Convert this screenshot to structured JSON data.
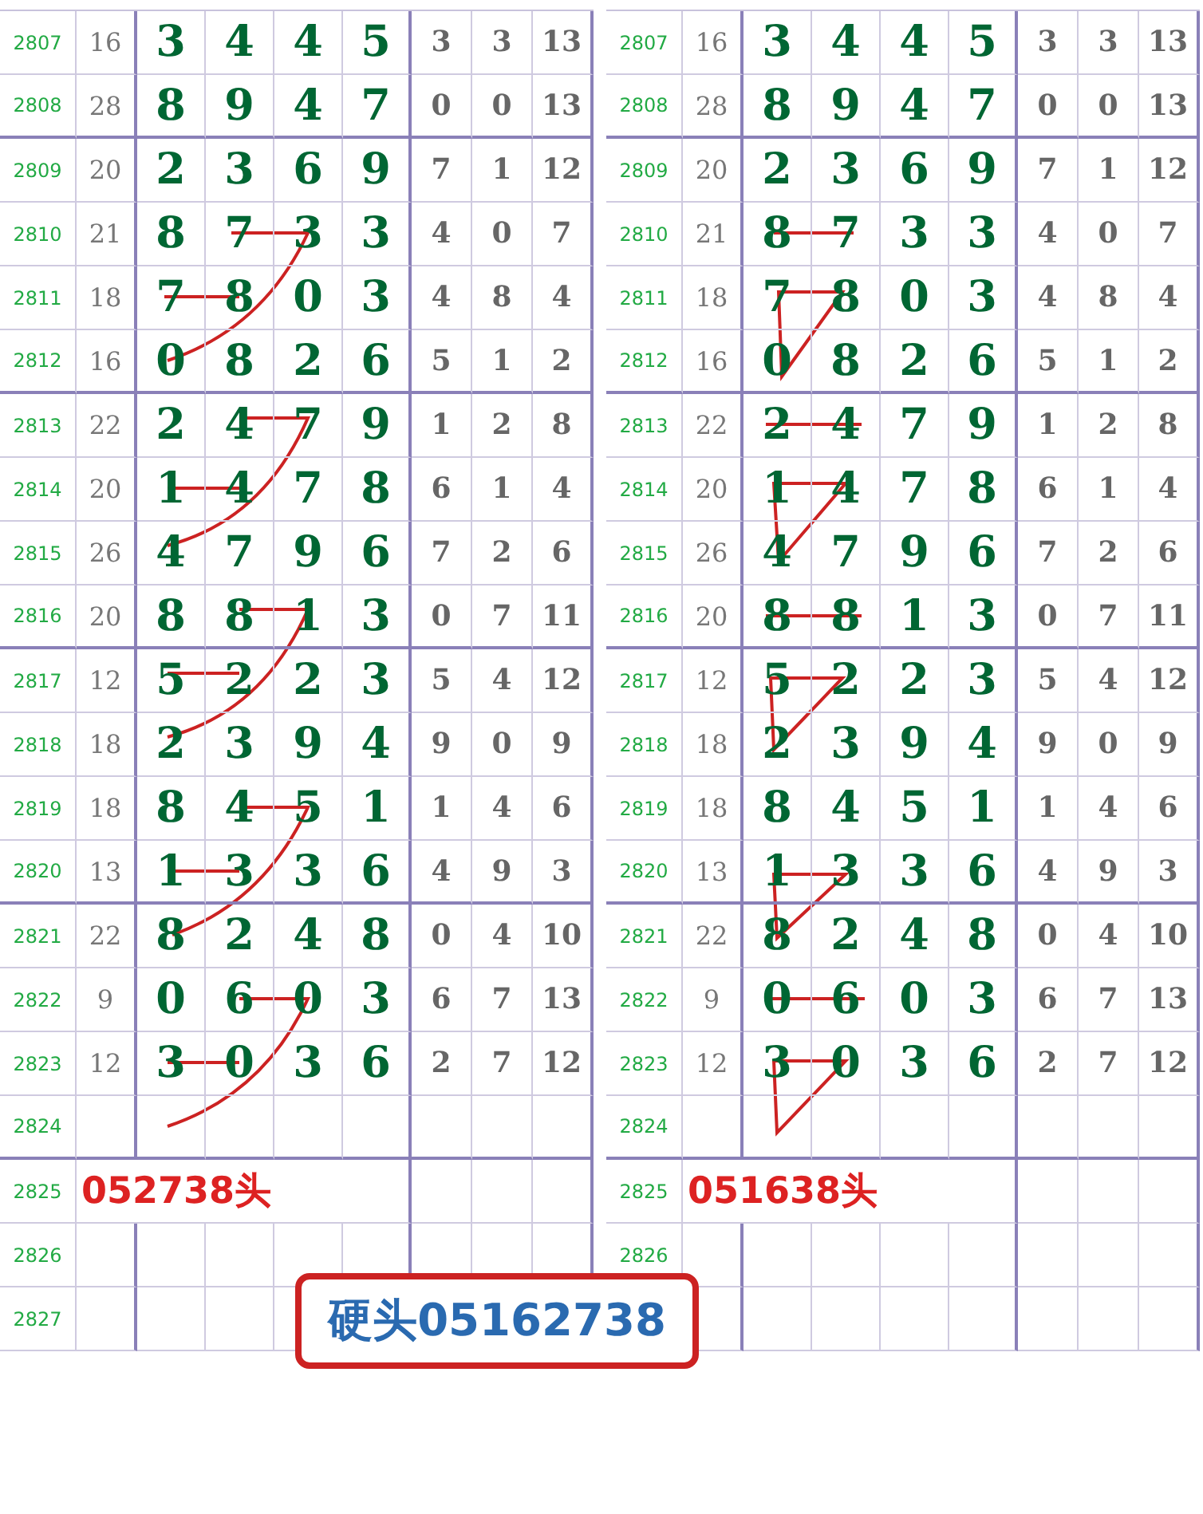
{
  "tables": [
    {
      "note": "052738头",
      "rows": [
        {
          "period": "2807",
          "count": "16",
          "digits": [
            "3",
            "4",
            "4",
            "5"
          ],
          "stats": [
            "3",
            "3",
            "13"
          ]
        },
        {
          "period": "2808",
          "count": "28",
          "digits": [
            "8",
            "9",
            "4",
            "7"
          ],
          "stats": [
            "0",
            "0",
            "13"
          ]
        },
        {
          "period": "2809",
          "count": "20",
          "digits": [
            "2",
            "3",
            "6",
            "9"
          ],
          "stats": [
            "7",
            "1",
            "12"
          ]
        },
        {
          "period": "2810",
          "count": "21",
          "digits": [
            "8",
            "7",
            "3",
            "3"
          ],
          "stats": [
            "4",
            "0",
            "7"
          ]
        },
        {
          "period": "2811",
          "count": "18",
          "digits": [
            "7",
            "8",
            "0",
            "3"
          ],
          "stats": [
            "4",
            "8",
            "4"
          ]
        },
        {
          "period": "2812",
          "count": "16",
          "digits": [
            "0",
            "8",
            "2",
            "6"
          ],
          "stats": [
            "5",
            "1",
            "2"
          ]
        },
        {
          "period": "2813",
          "count": "22",
          "digits": [
            "2",
            "4",
            "7",
            "9"
          ],
          "stats": [
            "1",
            "2",
            "8"
          ]
        },
        {
          "period": "2814",
          "count": "20",
          "digits": [
            "1",
            "4",
            "7",
            "8"
          ],
          "stats": [
            "6",
            "1",
            "4"
          ]
        },
        {
          "period": "2815",
          "count": "26",
          "digits": [
            "4",
            "7",
            "9",
            "6"
          ],
          "stats": [
            "7",
            "2",
            "6"
          ]
        },
        {
          "period": "2816",
          "count": "20",
          "digits": [
            "8",
            "8",
            "1",
            "3"
          ],
          "stats": [
            "0",
            "7",
            "11"
          ]
        },
        {
          "period": "2817",
          "count": "12",
          "digits": [
            "5",
            "2",
            "2",
            "3"
          ],
          "stats": [
            "5",
            "4",
            "12"
          ]
        },
        {
          "period": "2818",
          "count": "18",
          "digits": [
            "2",
            "3",
            "9",
            "4"
          ],
          "stats": [
            "9",
            "0",
            "9"
          ]
        },
        {
          "period": "2819",
          "count": "18",
          "digits": [
            "8",
            "4",
            "5",
            "1"
          ],
          "stats": [
            "1",
            "4",
            "6"
          ]
        },
        {
          "period": "2820",
          "count": "13",
          "digits": [
            "1",
            "3",
            "3",
            "6"
          ],
          "stats": [
            "4",
            "9",
            "3"
          ]
        },
        {
          "period": "2821",
          "count": "22",
          "digits": [
            "8",
            "2",
            "4",
            "8"
          ],
          "stats": [
            "0",
            "4",
            "10"
          ]
        },
        {
          "period": "2822",
          "count": "9",
          "digits": [
            "0",
            "6",
            "0",
            "3"
          ],
          "stats": [
            "6",
            "7",
            "13"
          ]
        },
        {
          "period": "2823",
          "count": "12",
          "digits": [
            "3",
            "0",
            "3",
            "6"
          ],
          "stats": [
            "2",
            "7",
            "12"
          ]
        },
        {
          "period": "2824"
        },
        {
          "period": "2825"
        },
        {
          "period": "2826"
        },
        {
          "period": "2827"
        }
      ]
    },
    {
      "note": "051638头",
      "rows": [
        {
          "period": "2807",
          "count": "16",
          "digits": [
            "3",
            "4",
            "4",
            "5"
          ],
          "stats": [
            "3",
            "3",
            "13"
          ]
        },
        {
          "period": "2808",
          "count": "28",
          "digits": [
            "8",
            "9",
            "4",
            "7"
          ],
          "stats": [
            "0",
            "0",
            "13"
          ]
        },
        {
          "period": "2809",
          "count": "20",
          "digits": [
            "2",
            "3",
            "6",
            "9"
          ],
          "stats": [
            "7",
            "1",
            "12"
          ]
        },
        {
          "period": "2810",
          "count": "21",
          "digits": [
            "8",
            "7",
            "3",
            "3"
          ],
          "stats": [
            "4",
            "0",
            "7"
          ]
        },
        {
          "period": "2811",
          "count": "18",
          "digits": [
            "7",
            "8",
            "0",
            "3"
          ],
          "stats": [
            "4",
            "8",
            "4"
          ]
        },
        {
          "period": "2812",
          "count": "16",
          "digits": [
            "0",
            "8",
            "2",
            "6"
          ],
          "stats": [
            "5",
            "1",
            "2"
          ]
        },
        {
          "period": "2813",
          "count": "22",
          "digits": [
            "2",
            "4",
            "7",
            "9"
          ],
          "stats": [
            "1",
            "2",
            "8"
          ]
        },
        {
          "period": "2814",
          "count": "20",
          "digits": [
            "1",
            "4",
            "7",
            "8"
          ],
          "stats": [
            "6",
            "1",
            "4"
          ]
        },
        {
          "period": "2815",
          "count": "26",
          "digits": [
            "4",
            "7",
            "9",
            "6"
          ],
          "stats": [
            "7",
            "2",
            "6"
          ]
        },
        {
          "period": "2816",
          "count": "20",
          "digits": [
            "8",
            "8",
            "1",
            "3"
          ],
          "stats": [
            "0",
            "7",
            "11"
          ]
        },
        {
          "period": "2817",
          "count": "12",
          "digits": [
            "5",
            "2",
            "2",
            "3"
          ],
          "stats": [
            "5",
            "4",
            "12"
          ]
        },
        {
          "period": "2818",
          "count": "18",
          "digits": [
            "2",
            "3",
            "9",
            "4"
          ],
          "stats": [
            "9",
            "0",
            "9"
          ]
        },
        {
          "period": "2819",
          "count": "18",
          "digits": [
            "8",
            "4",
            "5",
            "1"
          ],
          "stats": [
            "1",
            "4",
            "6"
          ]
        },
        {
          "period": "2820",
          "count": "13",
          "digits": [
            "1",
            "3",
            "3",
            "6"
          ],
          "stats": [
            "4",
            "9",
            "3"
          ]
        },
        {
          "period": "2821",
          "count": "22",
          "digits": [
            "8",
            "2",
            "4",
            "8"
          ],
          "stats": [
            "0",
            "4",
            "10"
          ]
        },
        {
          "period": "2822",
          "count": "9",
          "digits": [
            "0",
            "6",
            "0",
            "3"
          ],
          "stats": [
            "6",
            "7",
            "13"
          ]
        },
        {
          "period": "2823",
          "count": "12",
          "digits": [
            "3",
            "0",
            "3",
            "6"
          ],
          "stats": [
            "2",
            "7",
            "12"
          ]
        },
        {
          "period": "2824"
        },
        {
          "period": "2825"
        },
        {
          "period": "2826"
        },
        {}
      ]
    }
  ],
  "highlight": "硬头05162738"
}
